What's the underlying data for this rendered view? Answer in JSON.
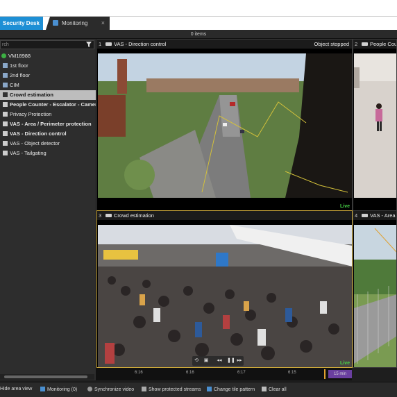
{
  "tabs": [
    {
      "label": "Security Desk"
    },
    {
      "label": "Monitoring",
      "close": "×"
    }
  ],
  "items_count": "0 items",
  "search": {
    "placeholder": "rch"
  },
  "tree": [
    {
      "label": "VM18988",
      "bold": false
    },
    {
      "label": "1st floor",
      "bold": false
    },
    {
      "label": "2nd floor",
      "bold": false
    },
    {
      "label": "CIM",
      "bold": false
    },
    {
      "label": "Crowd estimation",
      "bold": true,
      "selected": true
    },
    {
      "label": "People Counter - Escalator - Camera",
      "bold": true
    },
    {
      "label": "Privacy Protection",
      "bold": false
    },
    {
      "label": "VAS - Area / Perimeter protection",
      "bold": true
    },
    {
      "label": "VAS - Direction control",
      "bold": true
    },
    {
      "label": "VAS - Object detector",
      "bold": false
    },
    {
      "label": "VAS - Tailgating",
      "bold": false
    }
  ],
  "tiles": [
    {
      "num": "1",
      "title": "VAS - Direction control",
      "status": "Object stopped",
      "live": "Live"
    },
    {
      "num": "2",
      "title": "People Counter",
      "status": "",
      "live": ""
    },
    {
      "num": "3",
      "title": "Crowd estimation",
      "status": "",
      "live": "Live"
    },
    {
      "num": "4",
      "title": "VAS - Area",
      "status": "",
      "live": ""
    }
  ],
  "timeline": {
    "ticks": [
      "6:16",
      "6:16",
      "6:17",
      "6:15"
    ],
    "end_label": "15 min"
  },
  "bottombar": [
    {
      "label": "Hide area view",
      "icon": "panel-icon"
    },
    {
      "label": "Monitoring (0)",
      "icon": "monitor-icon"
    },
    {
      "label": "Synchronize video",
      "icon": "sync-icon"
    },
    {
      "label": "Show protected streams",
      "icon": "stream-icon"
    },
    {
      "label": "Change tile pattern",
      "icon": "pattern-icon"
    },
    {
      "label": "Clear all",
      "icon": "clear-icon"
    }
  ],
  "colors": {
    "accent": "#1e8fd5",
    "live": "#47d447",
    "active_tile": "#c9a63a"
  }
}
